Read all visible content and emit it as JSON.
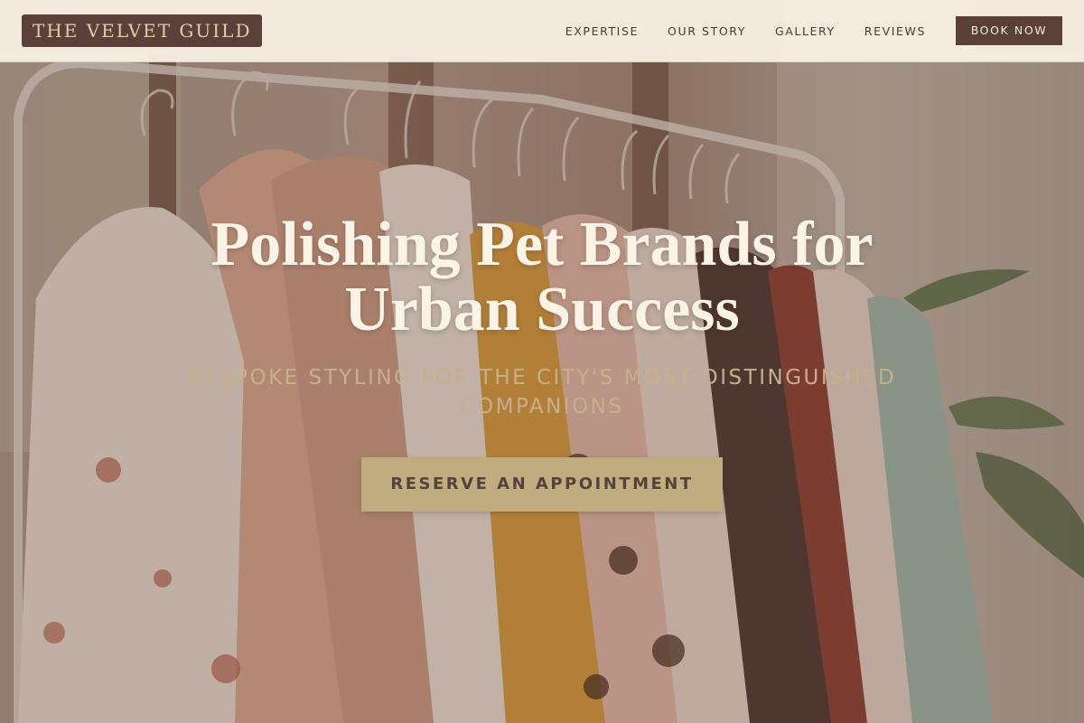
{
  "header": {
    "logo_text": "THE VELVET GUILD",
    "nav": [
      {
        "label": "EXPERTISE"
      },
      {
        "label": "OUR STORY"
      },
      {
        "label": "GALLERY"
      },
      {
        "label": "REVIEWS"
      }
    ],
    "cta_label": "BOOK NOW"
  },
  "hero": {
    "title_line1": "Polishing Pet Brands for",
    "title_line2": "Urban Success",
    "subtitle_line1": "BESPOKE STYLING FOR THE CITY'S MOST DISTINGUISHED",
    "subtitle_line2": "COMPANIONS",
    "button_label": "RESERVE AN APPOINTMENT",
    "background_image": "clothing-rack-photo"
  },
  "colors": {
    "brand_dark": "#5b4039",
    "accent_gold": "#c0ac7e",
    "header_bg": "#f8f0e4",
    "title_text": "#fbf3e6"
  }
}
